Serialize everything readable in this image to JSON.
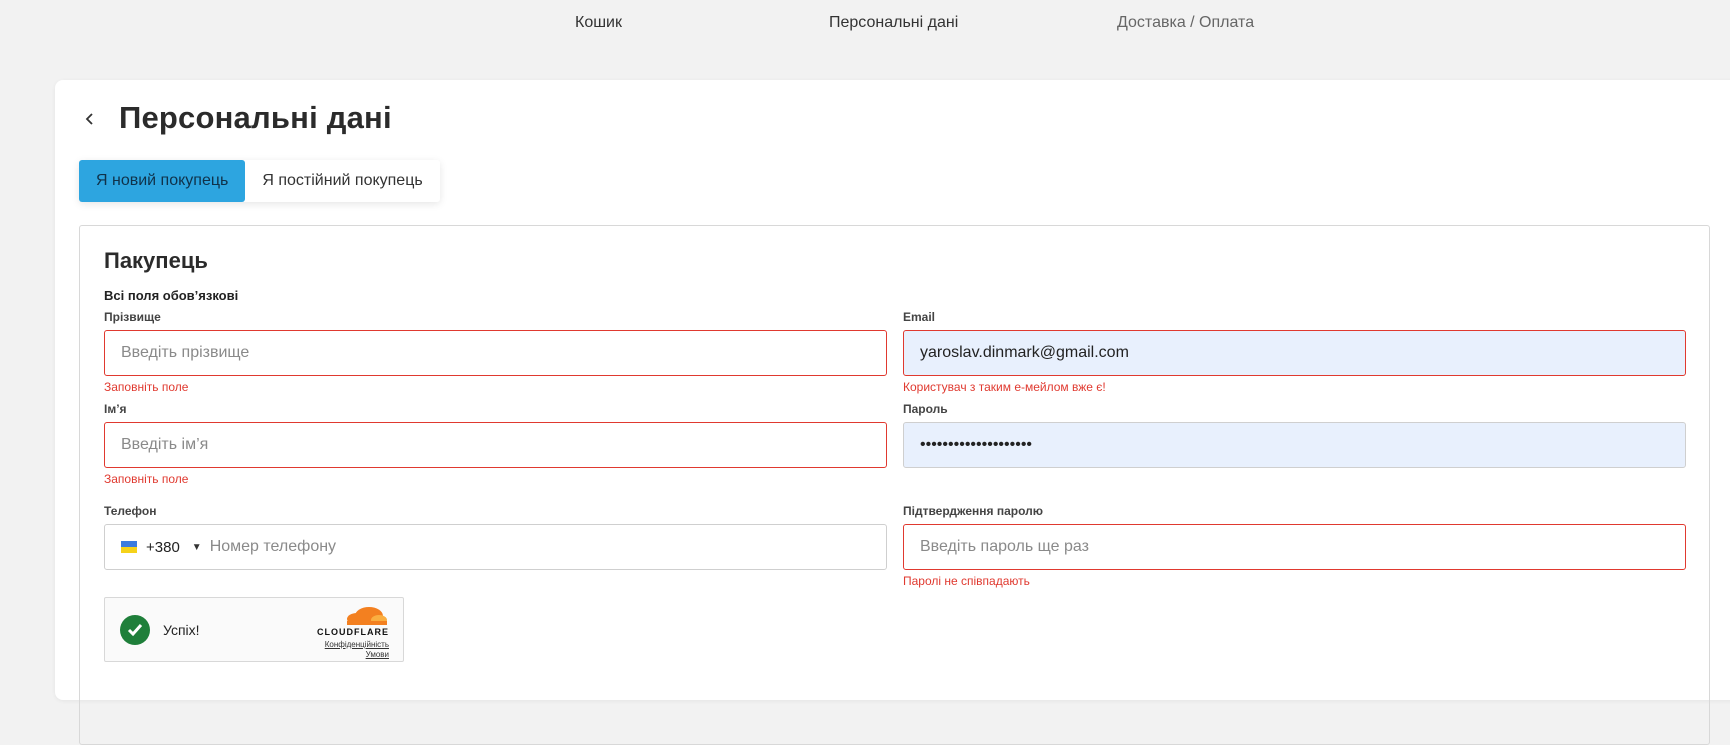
{
  "steps": {
    "cart": "Кошик",
    "personal": "Персональні дані",
    "delivery": "Доставка / Оплата"
  },
  "page": {
    "title": "Персональні дані",
    "back_icon": "chevron-left-icon"
  },
  "tabs": [
    {
      "label": "Я новий покупець",
      "active": true
    },
    {
      "label": "Я постійний покупець",
      "active": false
    }
  ],
  "form": {
    "title": "Пакупець",
    "required_note": "Всі поля обов’язкові",
    "surname": {
      "label": "Прізвище",
      "placeholder": "Введіть прізвище",
      "value": "",
      "error": "Заповніть поле"
    },
    "email": {
      "label": "Email",
      "value": "yaroslav.dinmark@gmail.com",
      "error": "Користувач з таким е-мейлом вже є!"
    },
    "name": {
      "label": "Ім’я",
      "placeholder": "Введіть ім’я",
      "value": "",
      "error": "Заповніть поле"
    },
    "password": {
      "label": "Пароль",
      "value": "••••••••••••••••••••"
    },
    "phone": {
      "label": "Телефон",
      "country_flag": "ukraine-flag-icon",
      "dial_code": "+380",
      "placeholder": "Номер телефону",
      "value": ""
    },
    "password_confirm": {
      "label": "Підтвердження паролю",
      "placeholder": "Введіть пароль ще раз",
      "value": "",
      "error": "Паролі не співпадають"
    }
  },
  "captcha": {
    "status": "Успіх!",
    "brand": "CLOUDFLARE",
    "privacy_link": "Конфіденційність",
    "terms_link": "Умови",
    "colors": {
      "check": "#1f7f3a",
      "cloud": "#f38020"
    }
  },
  "colors": {
    "accent": "#2da5e0",
    "error": "#e0392f",
    "autofill_bg": "#e8f0fd"
  }
}
